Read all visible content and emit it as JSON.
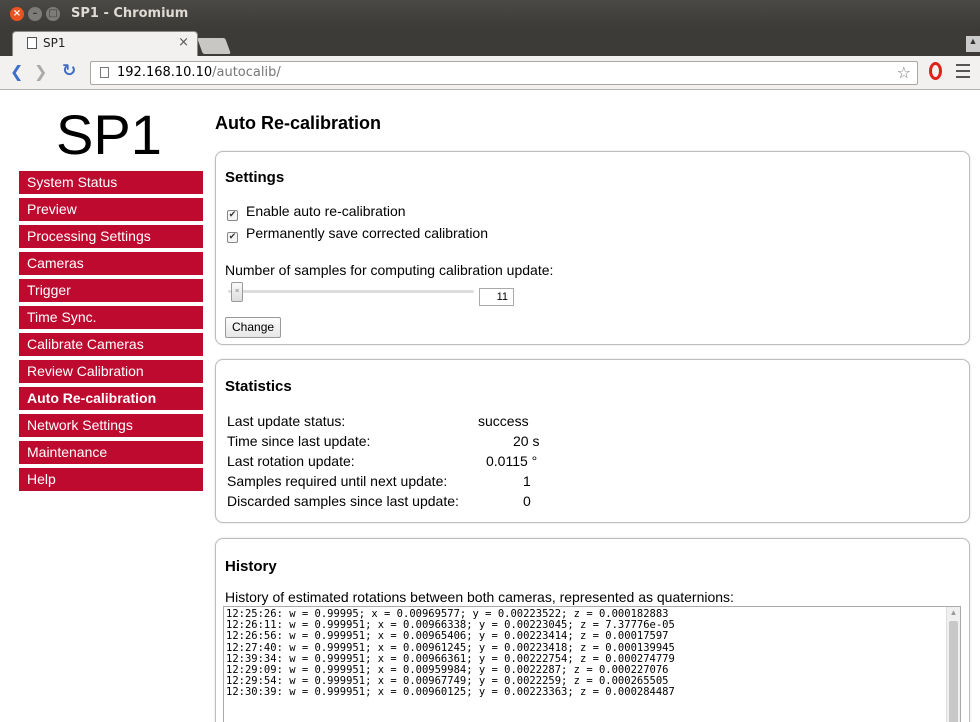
{
  "window": {
    "title": "SP1 - Chromium",
    "tab_title": "SP1",
    "tab_close": "×",
    "url_host": "192.168.10.10",
    "url_path": "/autocalib/"
  },
  "logo": "SP1",
  "sidebar": {
    "items": [
      {
        "label": "System Status"
      },
      {
        "label": "Preview"
      },
      {
        "label": "Processing Settings"
      },
      {
        "label": "Cameras"
      },
      {
        "label": "Trigger"
      },
      {
        "label": "Time Sync."
      },
      {
        "label": "Calibrate Cameras"
      },
      {
        "label": "Review Calibration"
      },
      {
        "label": "Auto Re-calibration",
        "active": true
      },
      {
        "label": "Network Settings"
      },
      {
        "label": "Maintenance"
      },
      {
        "label": "Help"
      }
    ],
    "active_color": "#bf0a30"
  },
  "page_title": "Auto Re-calibration",
  "settings": {
    "heading": "Settings",
    "enable_label": "Enable auto re-calibration",
    "enable_checked": true,
    "save_label": "Permanently save corrected calibration",
    "save_checked": true,
    "samples_label": "Number of samples for computing calibration update:",
    "samples_value": "11",
    "change_label": "Change"
  },
  "statistics": {
    "heading": "Statistics",
    "rows": [
      {
        "label": "Last update status:",
        "value": "success"
      },
      {
        "label": "Time since last update:",
        "value": "20 s"
      },
      {
        "label": "Last rotation update:",
        "value": "0.0115 °"
      },
      {
        "label": "Samples required until next update:",
        "value": "1"
      },
      {
        "label": "Discarded samples since last update:",
        "value": "0"
      }
    ]
  },
  "history": {
    "heading": "History",
    "description": "History of estimated rotations between both cameras, represented as quaternions:",
    "lines": [
      "12:25:26: w = 0.99995; x = 0.00969577; y = 0.00223522; z = 0.000182883",
      "12:26:11: w = 0.999951; x = 0.00966338; y = 0.00223045; z = 7.37776e-05",
      "12:26:56: w = 0.999951; x = 0.00965406; y = 0.00223414; z = 0.00017597",
      "12:27:40: w = 0.999951; x = 0.00961245; y = 0.00223418; z = 0.000139945",
      "12:39:34: w = 0.999951; x = 0.00966361; y = 0.00222754; z = 0.000274779",
      "12:29:09: w = 0.999951; x = 0.00959984; y = 0.0022287; z = 0.000227076",
      "12:29:54: w = 0.999951; x = 0.00967749; y = 0.0022259; z = 0.000265505",
      "12:30:39: w = 0.999951; x = 0.00960125; y = 0.00223363; z = 0.000284487"
    ]
  }
}
